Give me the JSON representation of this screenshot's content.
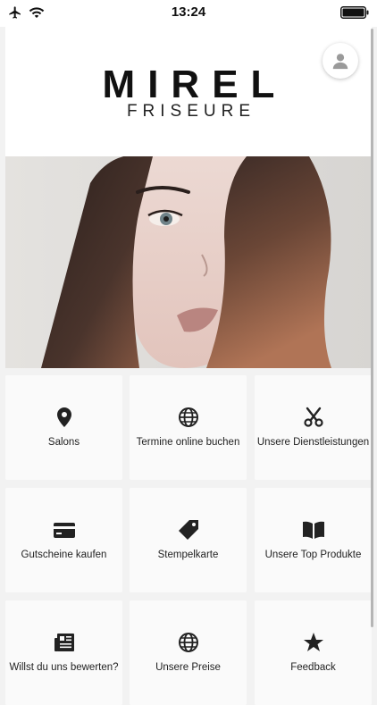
{
  "status_bar": {
    "time": "13:24"
  },
  "header": {
    "logo_title": "MIREL",
    "logo_subtitle": "FRISEURE"
  },
  "tiles": [
    {
      "label": "Salons",
      "icon": "map-pin-icon"
    },
    {
      "label": "Termine online buchen",
      "icon": "globe-icon"
    },
    {
      "label": "Unsere Dienstleistungen",
      "icon": "scissors-icon"
    },
    {
      "label": "Gutscheine kaufen",
      "icon": "credit-card-icon"
    },
    {
      "label": "Stempelkarte",
      "icon": "tag-icon"
    },
    {
      "label": "Unsere Top Produkte",
      "icon": "book-icon"
    },
    {
      "label": "Willst du uns bewerten?",
      "icon": "newspaper-icon"
    },
    {
      "label": "Unsere Preise",
      "icon": "globe-icon"
    },
    {
      "label": "Feedback",
      "icon": "star-icon"
    }
  ],
  "colors": {
    "icon": "#222222",
    "tile_bg": "#fafafa",
    "page_bg": "#f2f2f2"
  }
}
